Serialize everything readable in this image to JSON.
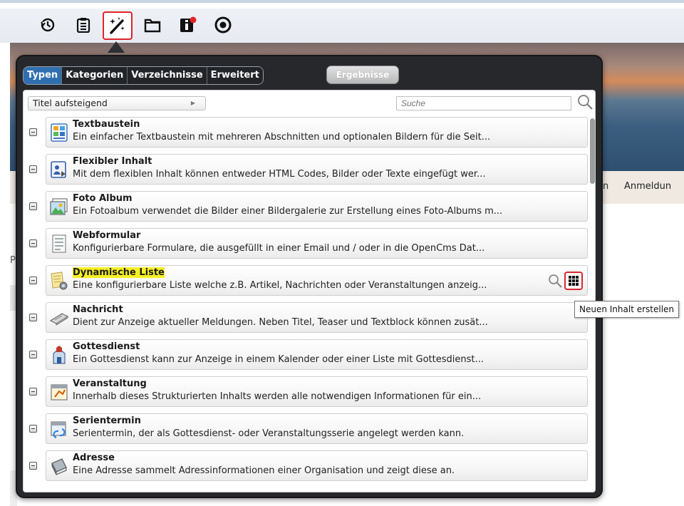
{
  "toolbar": {
    "buttons": [
      {
        "icon": "history-icon"
      },
      {
        "icon": "clipboard-icon"
      },
      {
        "icon": "magic-wand-icon",
        "active": true
      },
      {
        "icon": "folder-icon"
      },
      {
        "icon": "info-icon"
      },
      {
        "icon": "publish-icon"
      }
    ],
    "active_color": "#e0242a"
  },
  "background_page": {
    "nav_items": [
      "en",
      "Anmeldun"
    ],
    "left_text": "P"
  },
  "dialog": {
    "tabs": [
      {
        "label": "Typen",
        "active": true
      },
      {
        "label": "Kategorien"
      },
      {
        "label": "Verzeichnisse"
      },
      {
        "label": "Erweitert"
      }
    ],
    "results_label": "Ergebnisse",
    "sort": {
      "value": "Titel aufsteigend"
    },
    "search": {
      "placeholder": "Suche"
    },
    "items": [
      {
        "title": "Textbaustein",
        "description": "Ein einfacher Textbaustein mit mehreren Abschnitten und optionalen Bildern für die Seit...",
        "icon": "text-block-icon"
      },
      {
        "title": "Flexibler Inhalt",
        "description": "Mit dem flexiblen Inhalt können entweder HTML Codes, Bilder oder Texte eingefügt wer...",
        "icon": "flexible-content-icon"
      },
      {
        "title": "Foto Album",
        "description": "Ein Fotoalbum verwendet die Bilder einer Bildergalerie zur Erstellung eines Foto-Albums m...",
        "icon": "photo-album-icon"
      },
      {
        "title": "Webformular",
        "description": "Konfigurierbare Formulare, die ausgefüllt in einer Email und / oder in die OpenCms Dat...",
        "icon": "web-form-icon"
      },
      {
        "title": "Dynamische Liste",
        "description": "Eine konfigurierbare Liste welche z.B. Artikel, Nachrichten oder Veranstaltungen anzeig...",
        "icon": "dynamic-list-icon",
        "highlighted": true,
        "hovered": true
      },
      {
        "title": "Nachricht",
        "description": "Dient zur Anzeige aktueller Meldungen. Neben Titel, Teaser und Textblock können zusät...",
        "icon": "news-icon"
      },
      {
        "title": "Gottesdienst",
        "description": "Ein Gottesdienst kann zur Anzeige in einem Kalender oder einer Liste mit Gottesdienst...",
        "icon": "church-service-icon"
      },
      {
        "title": "Veranstaltung",
        "description": "Innerhalb dieses Strukturierten Inhalts werden alle notwendigen Informationen für ein...",
        "icon": "event-icon"
      },
      {
        "title": "Serientermin",
        "description": "Serientermin, der als Gottesdienst- oder Veranstaltungsserie angelegt werden kann.",
        "icon": "recurring-event-icon"
      },
      {
        "title": "Adresse",
        "description": "Eine Adresse sammelt Adressinformationen einer Organisation und zeigt diese an.",
        "icon": "address-book-icon"
      }
    ],
    "tooltip": "Neuen Inhalt erstellen",
    "highlight_color": "#f6f023"
  }
}
